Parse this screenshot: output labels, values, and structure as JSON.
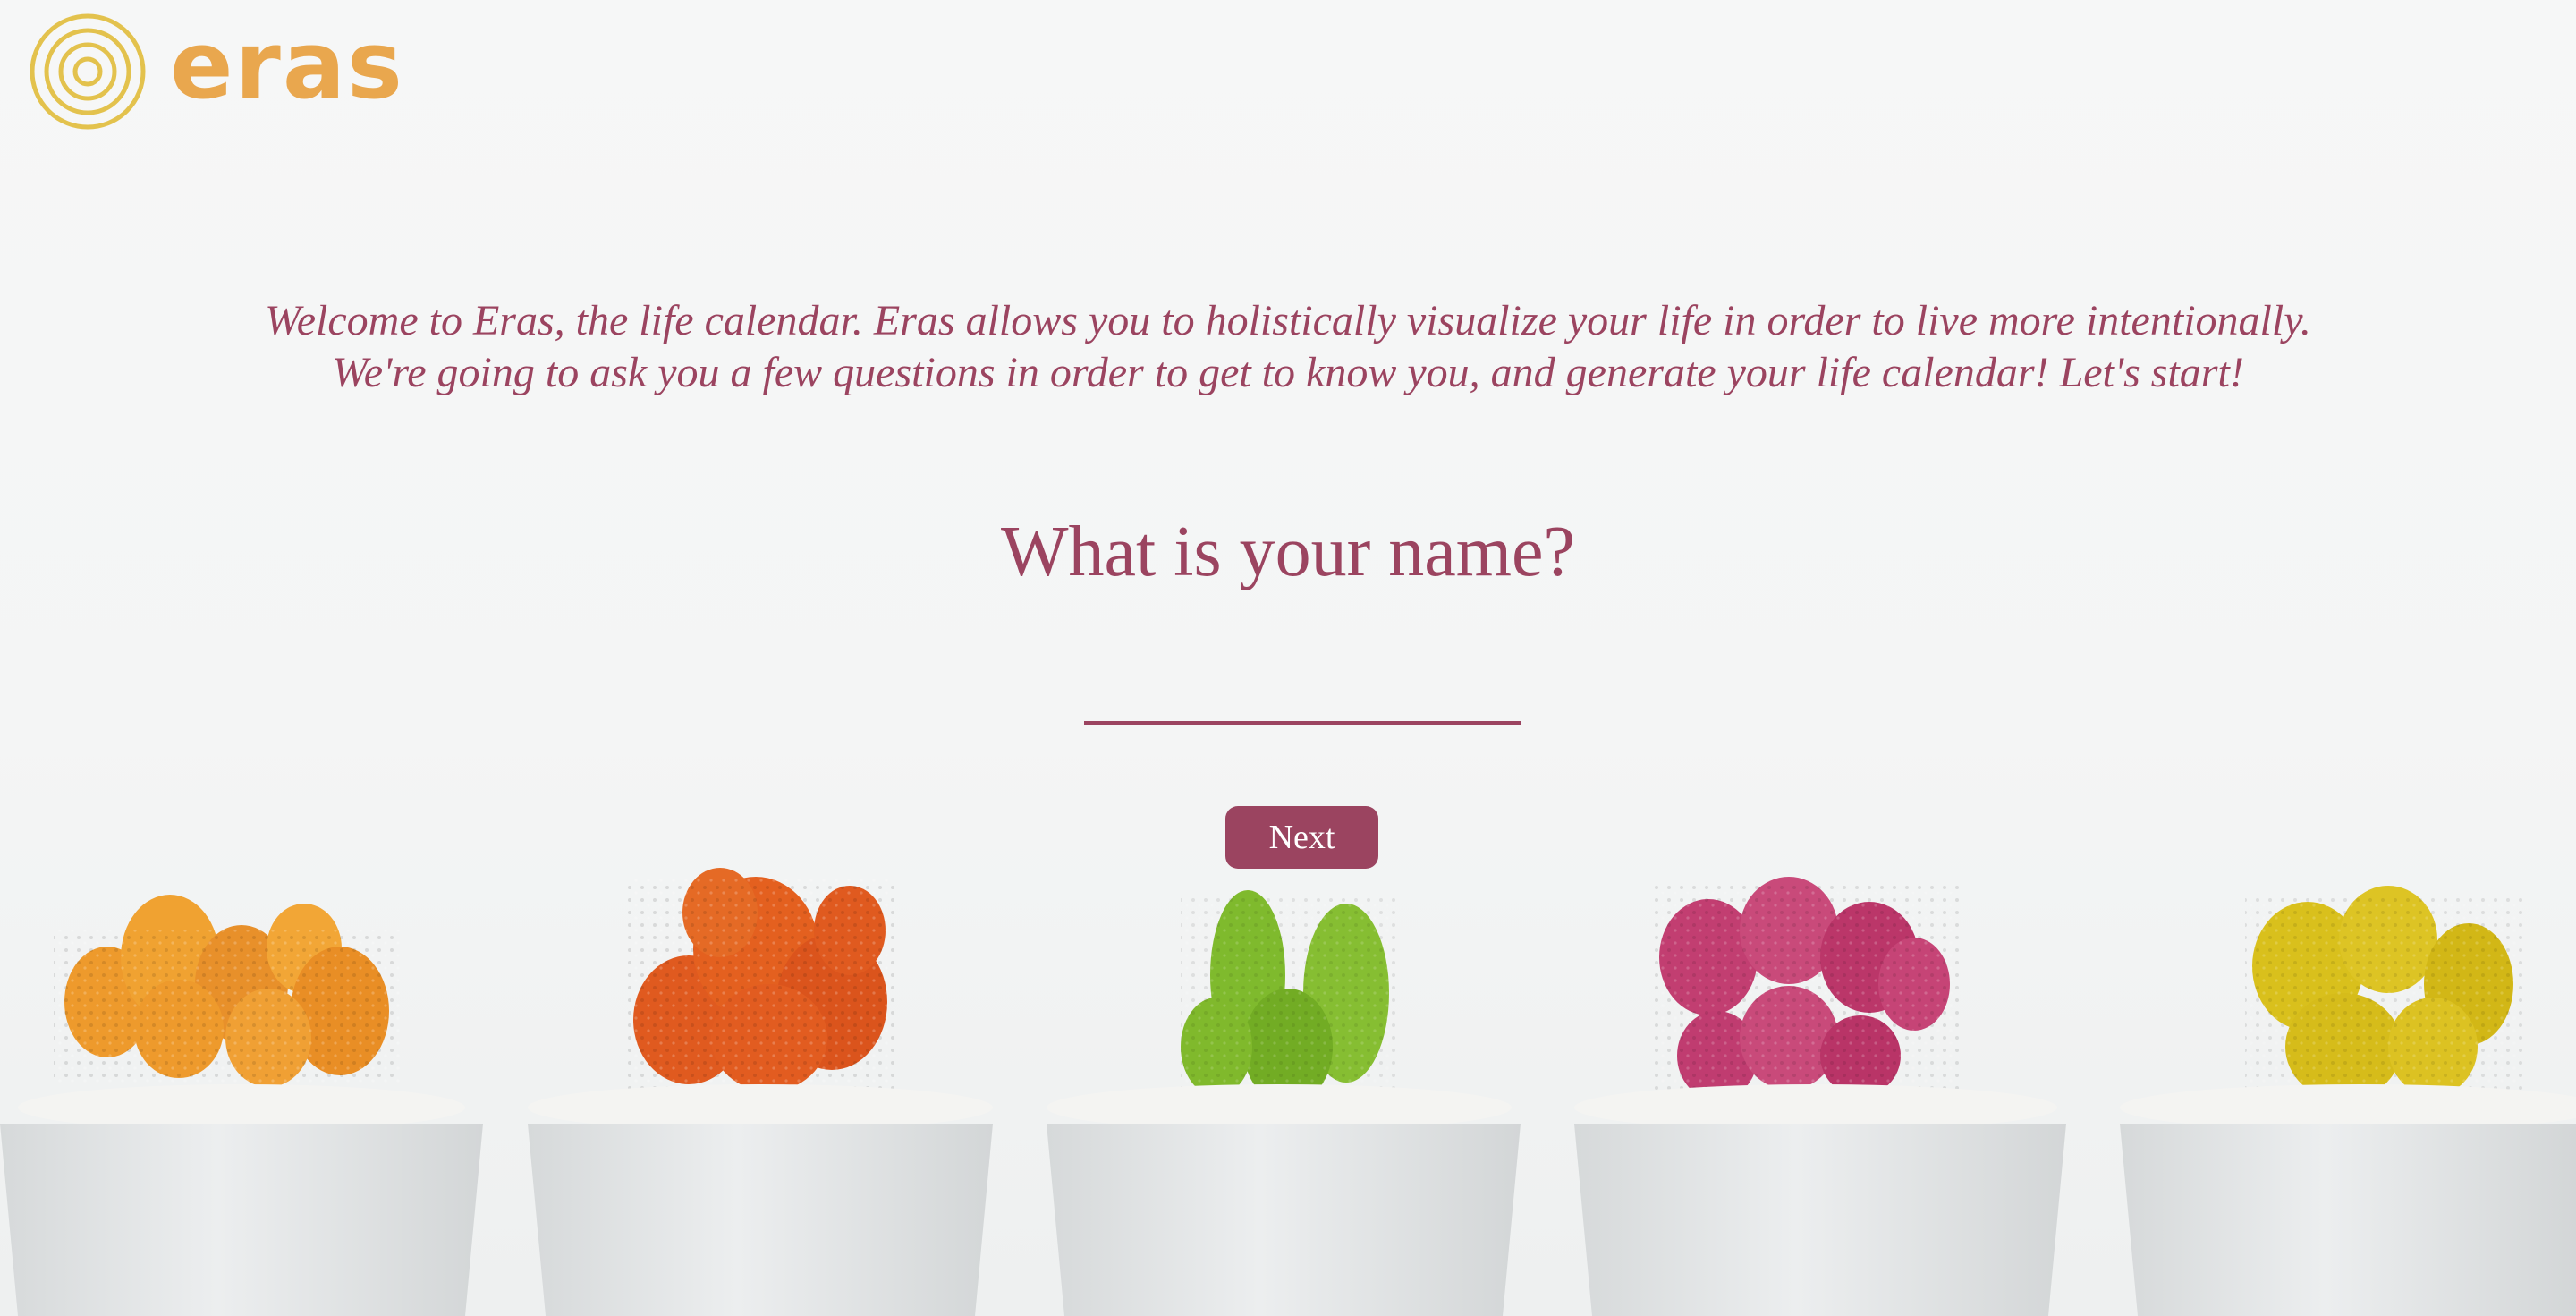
{
  "brand": {
    "name": "eras",
    "text_color": "#e9a74e",
    "mark_color": "#e3c24d"
  },
  "intro": {
    "line1": "Welcome to Eras, the life calendar. Eras allows you to holistically visualize your life in order to live more intentionally.",
    "line2": "We're going to ask you a few questions in order to get to know you, and generate your life calendar! Let's start!"
  },
  "form": {
    "question": "What is your name?",
    "name_value": "",
    "next_label": "Next"
  },
  "background": {
    "description_icon": "cactus-pots-illustration",
    "cactus_colors": [
      "#ef9a2a",
      "#e2581f",
      "#7cb82c",
      "#c03a6e",
      "#dcc21c"
    ]
  },
  "theme": {
    "accent": "#9b4460",
    "page_bg": "#f6f7f7"
  }
}
